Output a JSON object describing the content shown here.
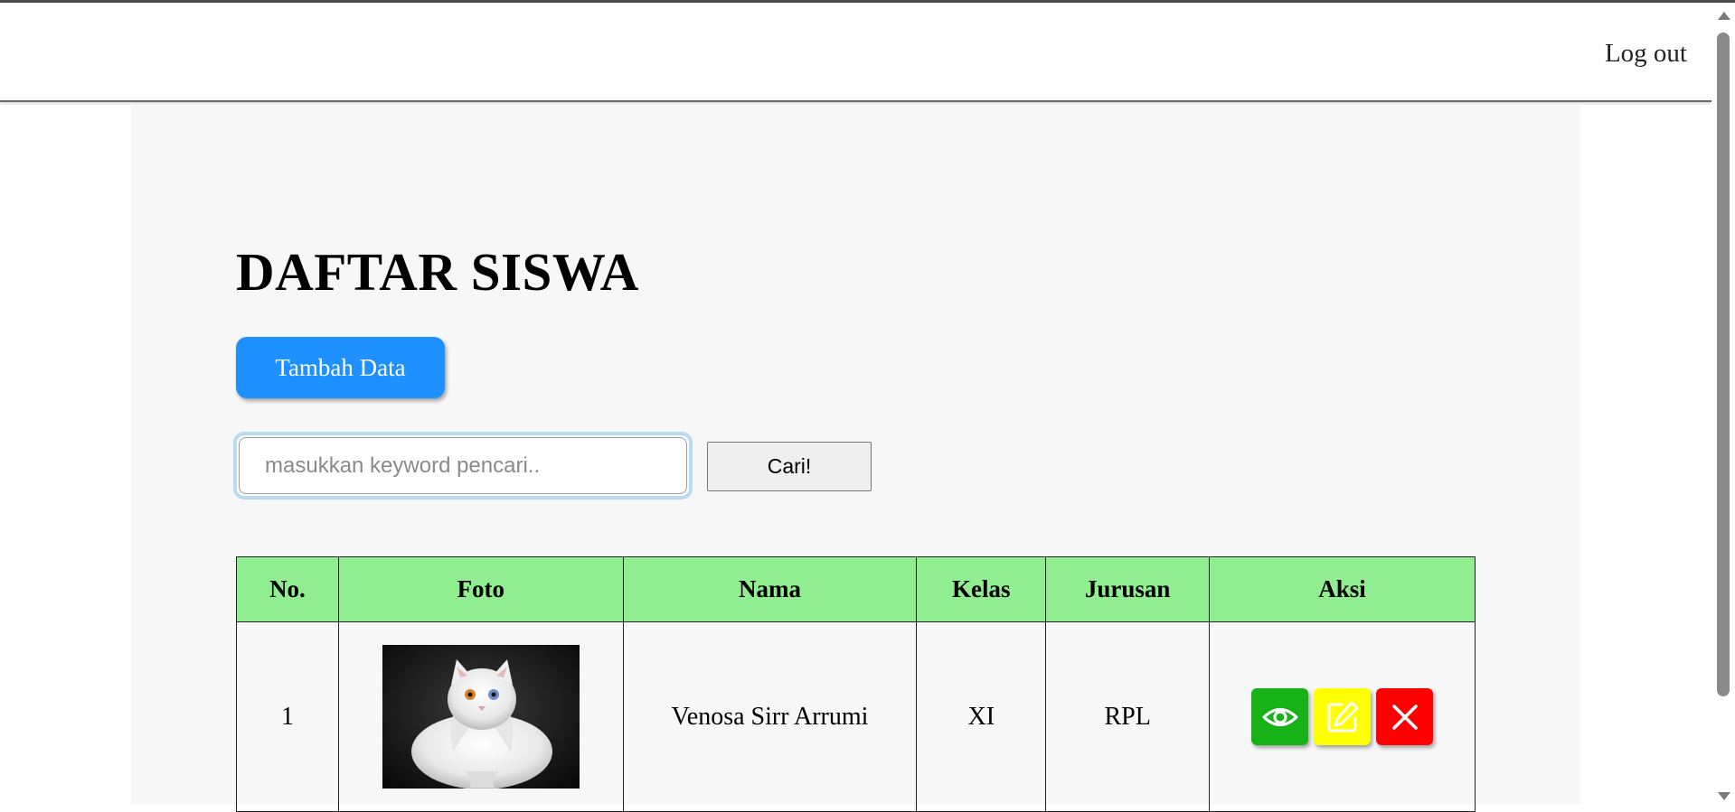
{
  "nav": {
    "logout_label": "Log out"
  },
  "page": {
    "title": "DAFTAR SISWA"
  },
  "toolbar": {
    "add_label": "Tambah Data",
    "search_placeholder": "masukkan keyword pencari..",
    "search_value": "",
    "search_button_label": "Cari!"
  },
  "table": {
    "headers": [
      "No.",
      "Foto",
      "Nama",
      "Kelas",
      "Jurusan",
      "Aksi"
    ],
    "rows": [
      {
        "no": "1",
        "nama": "Venosa Sirr Arrumi",
        "kelas": "XI",
        "jurusan": "RPL",
        "photo": "white-cat-photo",
        "actions": [
          "eye-icon",
          "edit-icon",
          "close-icon"
        ]
      }
    ]
  },
  "colors": {
    "add_button": "#1e90ff",
    "table_header": "#90ee90",
    "view_button": "#17b217",
    "edit_button": "#ffff00",
    "delete_button": "#ff0000",
    "content_bg": "#f7f7f7"
  }
}
